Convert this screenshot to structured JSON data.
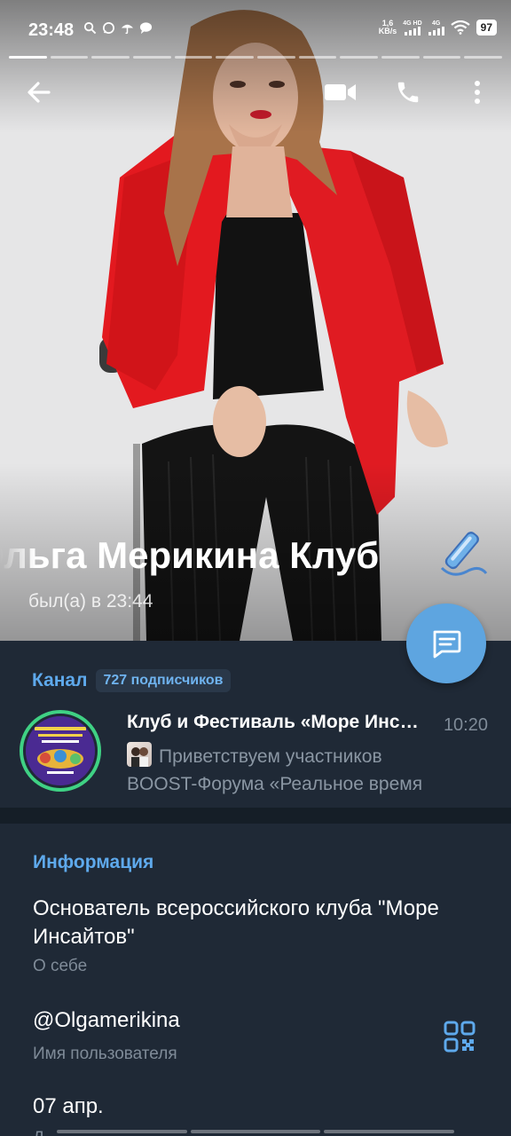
{
  "status_bar": {
    "time": "23:48",
    "net_speed_value": "1,6",
    "net_speed_unit": "KB/s",
    "sim1": "4G HD",
    "sim2": "4G",
    "battery": "97"
  },
  "profile": {
    "name": "Ольга Мерикина Клуб",
    "last_seen": "был(а) в 23:44",
    "story_segments": 12,
    "active_segment": 1
  },
  "channel": {
    "label": "Канал",
    "subscribers": "727 подписчиков",
    "title": "Клуб и Фестиваль «Море Инсайтов»",
    "time": "10:20",
    "preview_line1": "Приветствуем участников",
    "preview_line2": "BOOST-Форума «Реальное время",
    "avatar_colors": {
      "ring": "#3fd184",
      "fill": "#4a2a92"
    }
  },
  "info": {
    "title": "Информация",
    "bio": "Основатель всероссийского клуба \"Море Инсайтов\"",
    "bio_caption": "О себе",
    "username": "@Olgamerikina",
    "username_caption": "Имя пользователя",
    "birthday": "07 апр.",
    "birthday_caption": "Д"
  },
  "colors": {
    "accent": "#5ea9ec",
    "fab": "#5ea5e0",
    "background": "#1f2936",
    "secondary_text": "#7f8b98",
    "jacket": "#e3191f"
  },
  "icons": [
    "back-arrow-icon",
    "video-call-icon",
    "phone-icon",
    "more-vert-icon",
    "message-icon",
    "qr-code-icon",
    "premium-badge-icon"
  ]
}
